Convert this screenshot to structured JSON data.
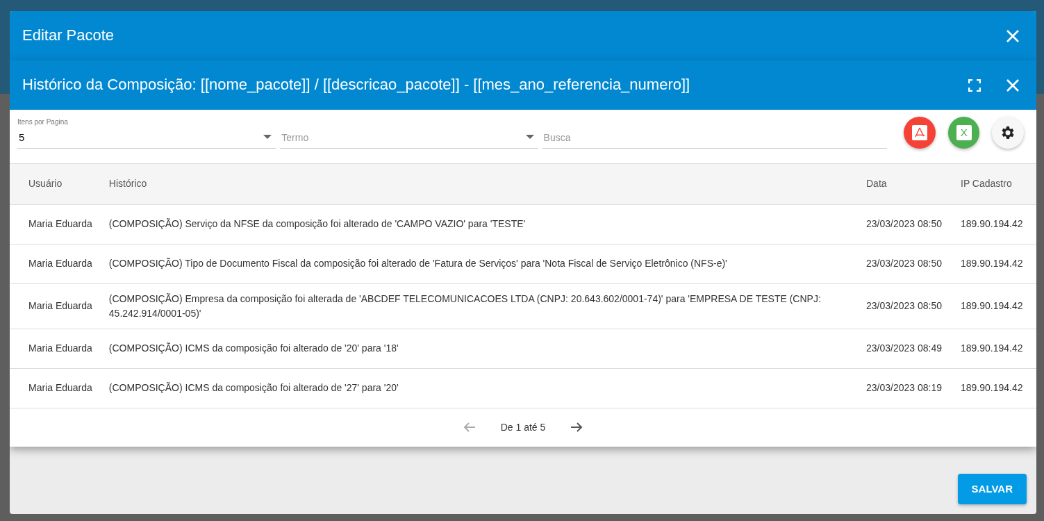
{
  "outer_dialog": {
    "title": "Editar Pacote",
    "save_button": "SALVAR"
  },
  "dialog": {
    "title": "Histórico da Composição: [[nome_pacote]] / [[descricao_pacote]] - [[mes_ano_referencia_numero]]"
  },
  "filters": [
    {
      "kind": "select",
      "label": "Itens por Pagina",
      "value": "5"
    },
    {
      "kind": "select",
      "placeholder": "Termo"
    },
    {
      "kind": "text",
      "placeholder": "Busca"
    }
  ],
  "actions": [
    {
      "kind": "pdf"
    },
    {
      "kind": "excel",
      "label": "X"
    },
    {
      "kind": "settings"
    }
  ],
  "table": {
    "columns": [
      "Usuário",
      "Histórico",
      "Data",
      "IP Cadastro"
    ],
    "rows": [
      [
        "Maria Eduarda",
        "(COMPOSIÇÃO) Serviço da NFSE da composição foi alterado de 'CAMPO VAZIO' para 'TESTE'",
        "23/03/2023 08:50",
        "189.90.194.42"
      ],
      [
        "Maria Eduarda",
        "(COMPOSIÇÃO) Tipo de Documento Fiscal da composição foi alterado de 'Fatura de Serviços' para 'Nota Fiscal de Serviço Eletrônico (NFS-e)'",
        "23/03/2023 08:50",
        "189.90.194.42"
      ],
      [
        "Maria Eduarda",
        "(COMPOSIÇÃO) Empresa da composição foi alterada de 'ABCDEF TELECOMUNICACOES LTDA (CNPJ: 20.643.602/0001-74)' para 'EMPRESA DE TESTE (CNPJ: 45.242.914/0001-05)'",
        "23/03/2023 08:50",
        "189.90.194.42"
      ],
      [
        "Maria Eduarda",
        "(COMPOSIÇÃO) ICMS da composição foi alterado de '20' para '18'",
        "23/03/2023 08:49",
        "189.90.194.42"
      ],
      [
        "Maria Eduarda",
        "(COMPOSIÇÃO) ICMS da composição foi alterado de '27' para '20'",
        "23/03/2023 08:19",
        "189.90.194.42"
      ]
    ]
  },
  "pagination": {
    "text": "De 1 até 5",
    "previous_disabled": true,
    "next_disabled": false
  }
}
